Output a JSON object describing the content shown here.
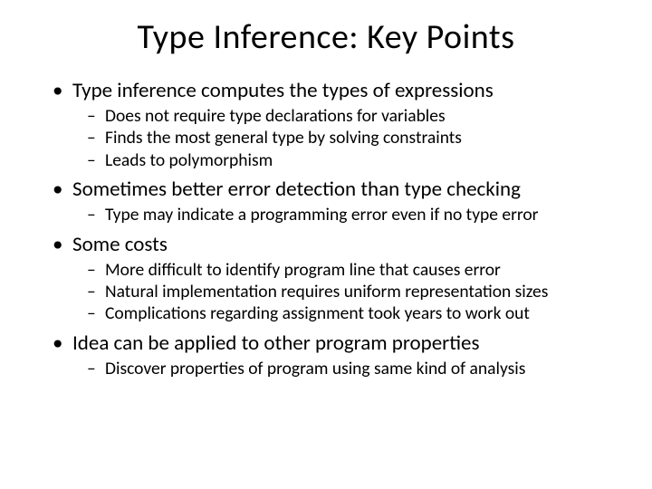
{
  "title": "Type Inference: Key Points",
  "bullets": [
    {
      "text": "Type inference computes the types of expressions",
      "sub": [
        "Does not require type declarations for variables",
        "Finds the most general type by solving constraints",
        "Leads to polymorphism"
      ]
    },
    {
      "text": "Sometimes better error detection than type checking",
      "sub": [
        "Type may indicate a programming error even if no type error"
      ]
    },
    {
      "text": "Some costs",
      "sub": [
        "More difficult to identify program line that causes error",
        "Natural implementation requires uniform representation sizes",
        "Complications regarding assignment took years to work out"
      ]
    },
    {
      "text": "Idea can be applied to other program properties",
      "sub": [
        "Discover properties of program using same kind of analysis"
      ]
    }
  ]
}
